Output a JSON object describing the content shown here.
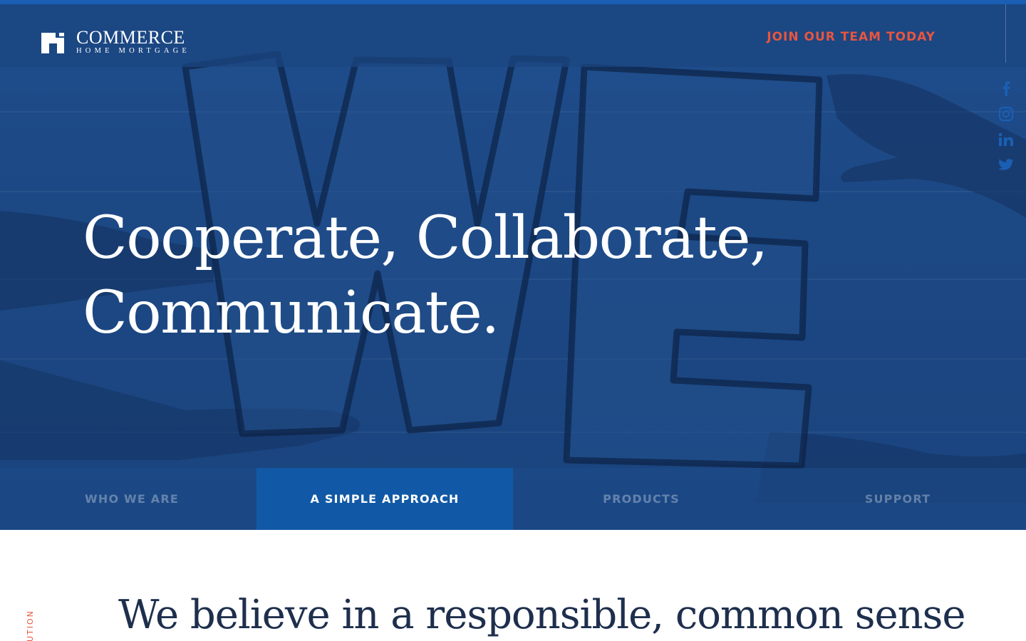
{
  "brand": {
    "name": "COMMERCE",
    "tagline": "HOME MORTGAGE"
  },
  "header": {
    "cta_label": "JOIN OUR TEAM TODAY"
  },
  "social": {
    "items": [
      {
        "icon": "facebook-icon"
      },
      {
        "icon": "instagram-icon"
      },
      {
        "icon": "linkedin-icon"
      },
      {
        "icon": "twitter-icon"
      }
    ]
  },
  "hero": {
    "headline_line1": "Cooperate, Collaborate,",
    "headline_line2": "Communicate."
  },
  "tabs": [
    {
      "label": "WHO WE ARE",
      "active": false
    },
    {
      "label": "A SIMPLE APPROACH",
      "active": true
    },
    {
      "label": "PRODUCTS",
      "active": false
    },
    {
      "label": "SUPPORT",
      "active": false
    }
  ],
  "content": {
    "side_label": "UTION",
    "intro_text": "We believe in a responsible, common sense"
  },
  "colors": {
    "hero_blue": "#1c4884",
    "active_tab": "#1159a6",
    "accent_coral": "#e8553f",
    "text_navy": "#1e2f4d"
  }
}
